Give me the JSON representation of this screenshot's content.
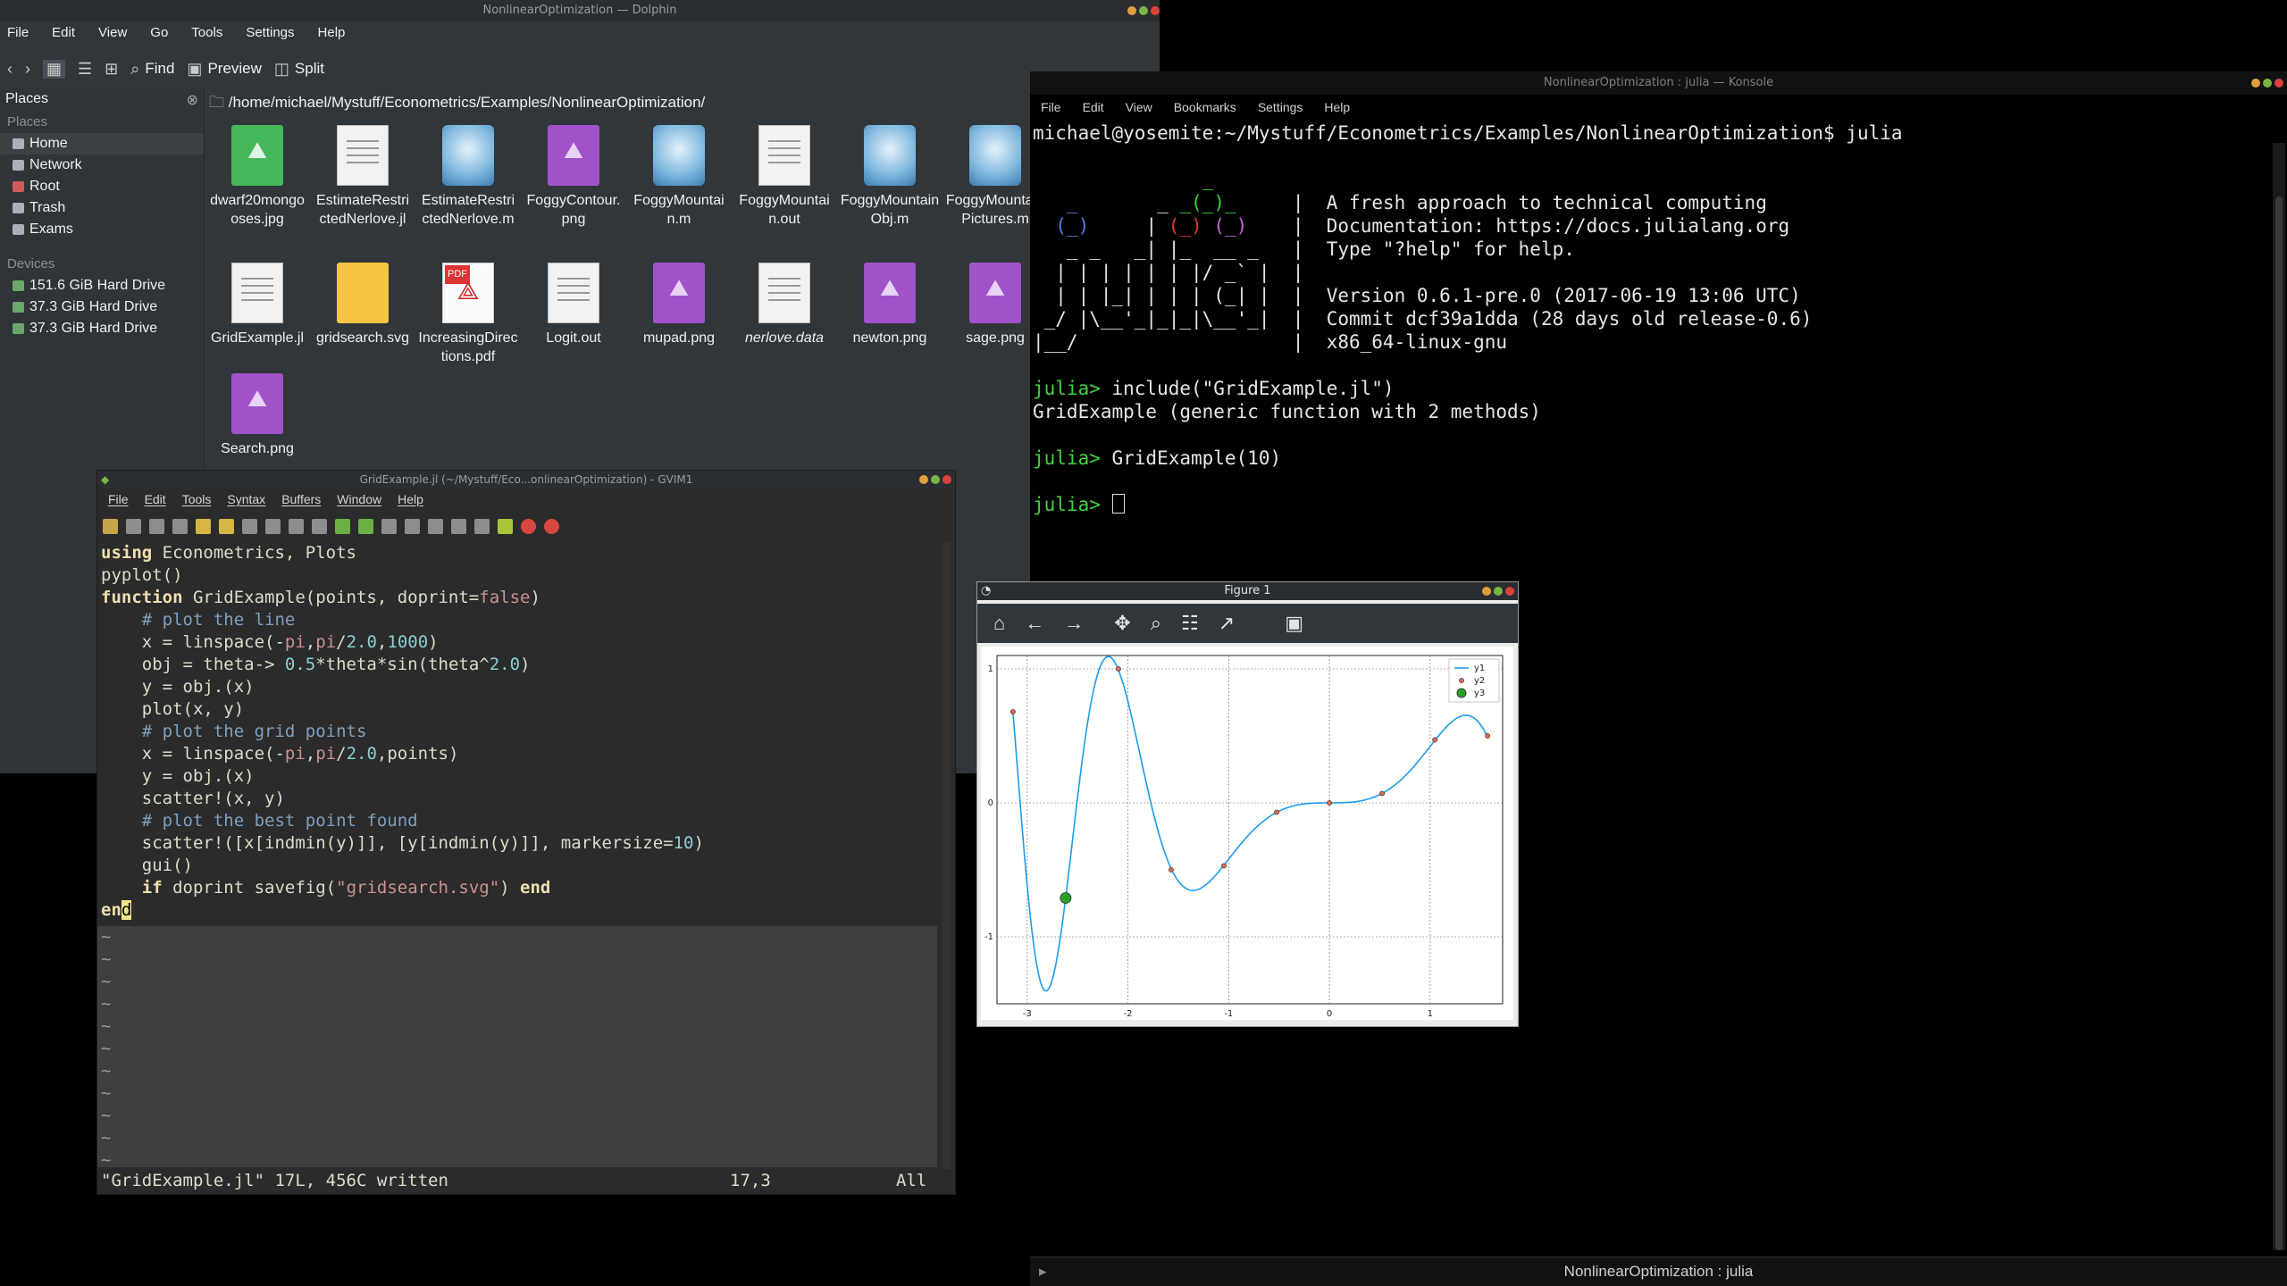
{
  "dolphin": {
    "title": "NonlinearOptimization — Dolphin",
    "menu": [
      "File",
      "Edit",
      "View",
      "Go",
      "Tools",
      "Settings",
      "Help"
    ],
    "toolbar": {
      "find": "Find",
      "preview": "Preview",
      "split": "Split"
    },
    "places_title": "Places",
    "places_section": "Places",
    "places": [
      "Home",
      "Network",
      "Root",
      "Trash",
      "Exams"
    ],
    "devices_section": "Devices",
    "devices": [
      "151.6 GiB Hard Drive",
      "37.3 GiB Hard Drive",
      "37.3 GiB Hard Drive"
    ],
    "path": "/home/michael/Mystuff/Econometrics/Examples/NonlinearOptimization/",
    "files": [
      {
        "name": "dwarf20mongooses.jpg",
        "icon": "image-green-icon"
      },
      {
        "name": "EstimateRestrictedNerlove.jl",
        "icon": "text-file-icon"
      },
      {
        "name": "EstimateRestrictedNerlove.m",
        "icon": "octave-file-icon"
      },
      {
        "name": "FoggyContour.png",
        "icon": "image-icon"
      },
      {
        "name": "FoggyMountain.m",
        "icon": "octave-file-icon"
      },
      {
        "name": "FoggyMountain.out",
        "icon": "text-file-icon"
      },
      {
        "name": "FoggyMountainObj.m",
        "icon": "octave-file-icon"
      },
      {
        "name": "FoggyMountainPictures.m",
        "icon": "octave-file-icon"
      },
      {
        "name": "GridExample.jl",
        "icon": "text-file-icon"
      },
      {
        "name": "gridsearch.svg",
        "icon": "svg-file-icon"
      },
      {
        "name": "IncreasingDirections.pdf",
        "icon": "pdf-file-icon"
      },
      {
        "name": "Logit.out",
        "icon": "text-file-icon"
      },
      {
        "name": "mupad.png",
        "icon": "image-icon"
      },
      {
        "name": "nerlove.data",
        "icon": "text-file-icon"
      },
      {
        "name": "newton.png",
        "icon": "image-icon"
      },
      {
        "name": "sage.png",
        "icon": "image-icon"
      },
      {
        "name": "Search.png",
        "icon": "image-icon"
      }
    ]
  },
  "konsole": {
    "title": "NonlinearOptimization : julia — Konsole",
    "menu": [
      "File",
      "Edit",
      "View",
      "Bookmarks",
      "Settings",
      "Help"
    ],
    "tab_label": "NonlinearOptimization : julia"
  },
  "gvim": {
    "title": "GridExample.jl (~/Mystuff/Eco...onlinearOptimization) - GVIM1",
    "menu": [
      "File",
      "Edit",
      "Tools",
      "Syntax",
      "Buffers",
      "Window",
      "Help"
    ],
    "status": "\"GridExample.jl\" 17L, 456C written",
    "position": "17,3",
    "scroll": "All"
  },
  "figure": {
    "title": "Figure 1",
    "toolbar_icons": [
      "home-icon",
      "back-arrow-icon",
      "forward-arrow-icon",
      "pan-icon",
      "zoom-icon",
      "configure-subplots-icon",
      "edit-axis-icon",
      "save-icon"
    ]
  },
  "chart_data": {
    "type": "line",
    "title": "",
    "xlabel": "",
    "ylabel": "",
    "xlim": [
      -3.3,
      1.72
    ],
    "ylim": [
      -1.5,
      1.1
    ],
    "xticks": [
      -3,
      -2,
      -1,
      0,
      1
    ],
    "yticks": [
      -1,
      0,
      1
    ],
    "grid": true,
    "legend_position": "top-right",
    "series": [
      {
        "name": "y1",
        "kind": "line",
        "color": "#1f9be8"
      },
      {
        "name": "y2",
        "kind": "scatter",
        "color": "#e06c4c",
        "x": [
          -3.1416,
          -2.6181,
          -2.0944,
          -1.5708,
          -1.0472,
          -0.5236,
          0.0,
          0.5236,
          1.0472,
          1.5708
        ],
        "y": [
          0.68,
          -0.71,
          1.0,
          -0.5,
          -0.47,
          -0.07,
          0.0,
          0.07,
          0.47,
          0.5
        ]
      },
      {
        "name": "y3",
        "kind": "scatter",
        "color": "#2ca02c",
        "x": [
          -2.6181
        ],
        "y": [
          -0.71
        ]
      }
    ]
  }
}
